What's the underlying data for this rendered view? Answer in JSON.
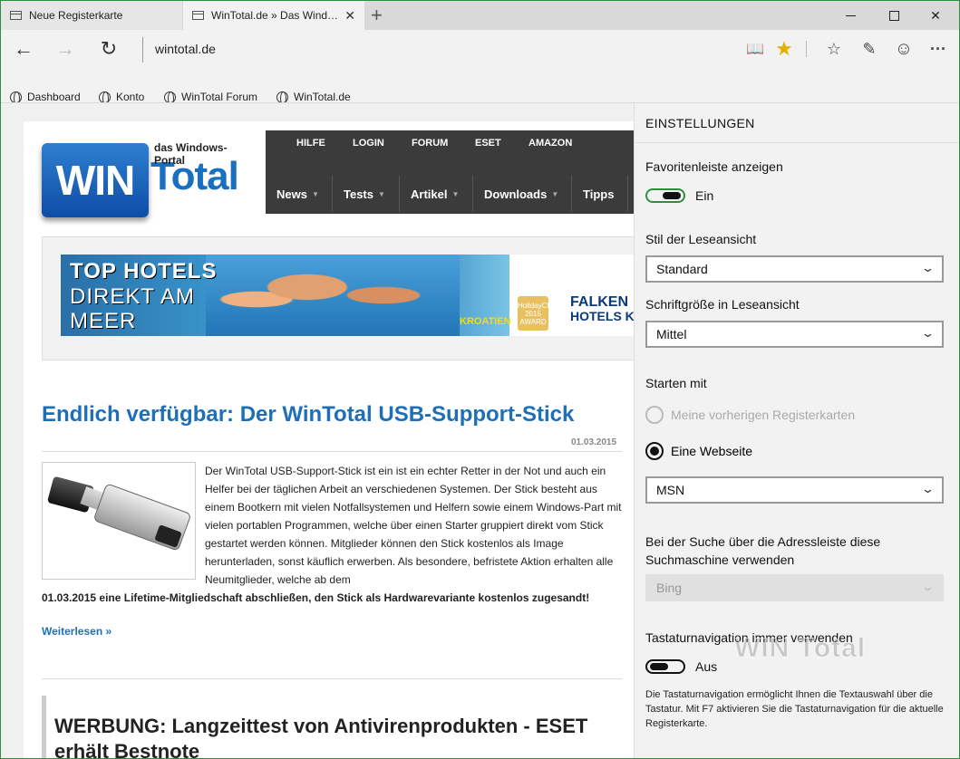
{
  "tabs": [
    {
      "label": "Neue Registerkarte"
    },
    {
      "label": "WinTotal.de » Das Wind…"
    }
  ],
  "tab_close": "✕",
  "new_tab": "+",
  "address": "wintotal.de",
  "favorites": [
    {
      "label": "Dashboard"
    },
    {
      "label": "Konto"
    },
    {
      "label": "WinTotal Forum"
    },
    {
      "label": "WinTotal.de"
    }
  ],
  "site": {
    "logo_win": "WIN",
    "logo_total": "Total",
    "logo_portal": "das Windows-Portal",
    "top_links": [
      "HILFE",
      "LOGIN",
      "FORUM",
      "ESET",
      "AMAZON"
    ],
    "menu": [
      "News",
      "Tests",
      "Artikel",
      "Downloads",
      "Tipps"
    ]
  },
  "banner": {
    "line1": "TOP HOTELS",
    "line2": "DIREKT AM",
    "line3": "MEER",
    "kroatien": "KROATIEN",
    "award": "HolidayCheck 2015 AWARD",
    "falken1": "FALKEN",
    "falken2": "HOTELS K"
  },
  "article": {
    "title": "Endlich verfügbar: Der WinTotal USB-Support-Stick",
    "date": "01.03.2015",
    "body": "Der WinTotal USB-Support-Stick ist ein ist ein echter Retter in der Not und auch ein Helfer bei der täglichen Arbeit an verschiedenen Systemen. Der Stick besteht aus einem Bootkern mit vielen Notfallsystemen und Helfern sowie einem Windows-Part mit vielen portablen Programmen, welche über einen Starter gruppiert direkt vom Stick gestartet werden können. Mitglieder können den Stick kostenlos als Image herunterladen, sonst käuflich erwerben. Als besondere, befristete Aktion erhalten alle Neumitglieder, welche ab dem",
    "body2": "01.03.2015 eine Lifetime-Mitgliedschaft abschließen, den Stick als Hardwarevariante kostenlos zugesandt!",
    "readmore": "Weiterlesen »"
  },
  "ad": {
    "title": "WERBUNG: Langzeittest von Antivirenprodukten - ESET erhält Bestnote"
  },
  "settings": {
    "title": "EINSTELLUNGEN",
    "fav_label": "Favoritenleiste anzeigen",
    "fav_state": "Ein",
    "reading_style_label": "Stil der Leseansicht",
    "reading_style_value": "Standard",
    "font_size_label": "Schriftgröße in Leseansicht",
    "font_size_value": "Mittel",
    "start_label": "Starten mit",
    "radio_prev": "Meine vorherigen Registerkarten",
    "radio_page": "Eine Webseite",
    "page_value": "MSN",
    "search_label": "Bei der Suche über die Adressleiste diese Suchmaschine verwenden",
    "search_value": "Bing",
    "caret_label": "Tastaturnavigation immer verwenden",
    "caret_state": "Aus",
    "caret_note": "Die Tastaturnavigation ermöglicht Ihnen die Textauswahl über die Tastatur. Mit F7 aktivieren Sie die Tastaturnavigation für die aktuelle Registerkarte."
  },
  "watermark": "WIN Total",
  "colors": {
    "accent_green": "#2b8f3d",
    "link_blue": "#1e6fb7",
    "nav_dark": "#3b3b3b"
  }
}
